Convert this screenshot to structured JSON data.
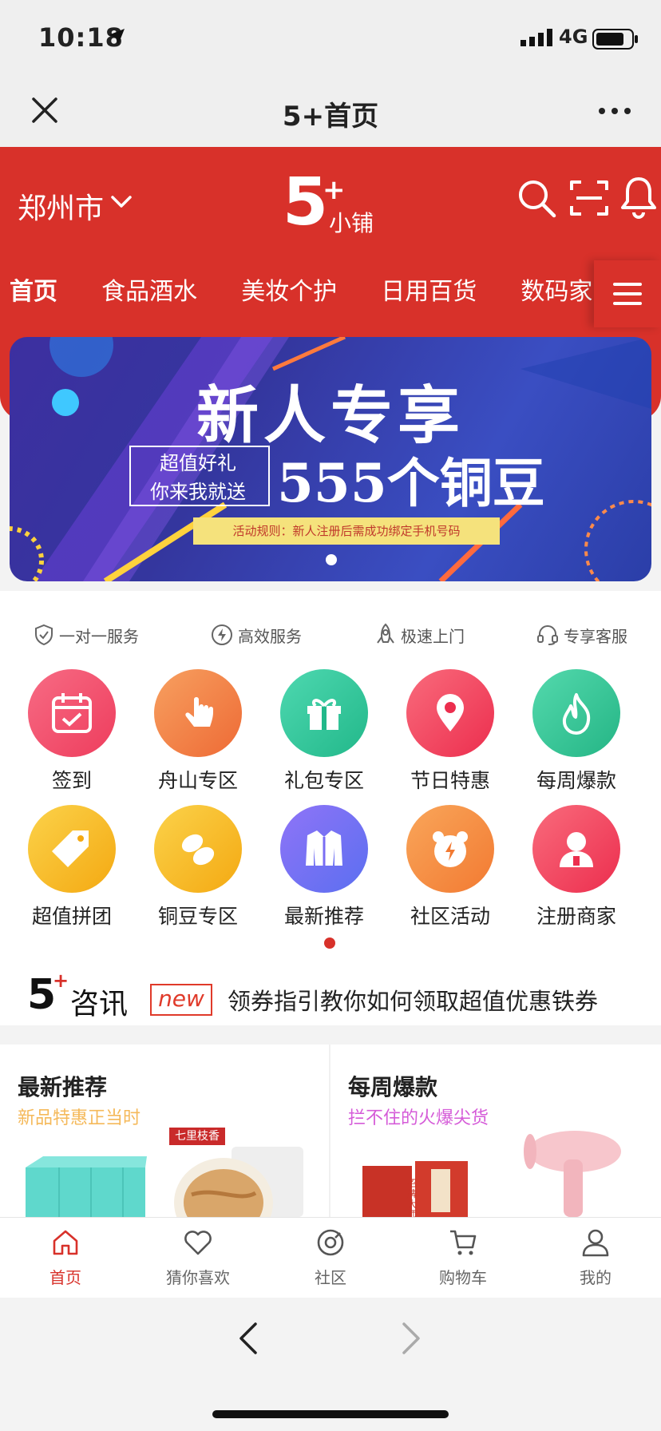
{
  "status": {
    "time": "10:18",
    "network": "4G"
  },
  "titlebar": {
    "title": "5+首页"
  },
  "header": {
    "city": "郑州市",
    "logo": {
      "main": "5",
      "sub": "小铺"
    },
    "tabs": [
      "首页",
      "食品酒水",
      "美妆个护",
      "日用百货",
      "数码家电"
    ]
  },
  "banner": {
    "title": "新人专享",
    "sub_line1": "超值好礼",
    "sub_line2": "你来我就送",
    "highlight": "555个铜豆",
    "rule": "活动规则：新人注册后需成功绑定手机号码"
  },
  "services": [
    "一对一服务",
    "高效服务",
    "极速上门",
    "专享客服"
  ],
  "grid": [
    {
      "label": "签到",
      "icon": "calendar-check-icon",
      "color": "#f04f6c"
    },
    {
      "label": "舟山专区",
      "icon": "tap-hand-icon",
      "color": "#f37b47"
    },
    {
      "label": "礼包专区",
      "icon": "gift-icon",
      "color": "#2fc59b"
    },
    {
      "label": "节日特惠",
      "icon": "location-pin-icon",
      "color": "#f0465f"
    },
    {
      "label": "每周爆款",
      "icon": "flame-icon",
      "color": "#31c796"
    },
    {
      "label": "超值拼团",
      "icon": "tag-icon",
      "color": "#f6b725"
    },
    {
      "label": "铜豆专区",
      "icon": "beans-icon",
      "color": "#f6b725"
    },
    {
      "label": "最新推荐",
      "icon": "jacket-icon",
      "color": "#7a5cf0"
    },
    {
      "label": "社区活动",
      "icon": "bear-bolt-icon",
      "color": "#f7863f"
    },
    {
      "label": "注册商家",
      "icon": "merchant-user-icon",
      "color": "#f0465f"
    }
  ],
  "news": {
    "brand": "咨讯",
    "badge": "new",
    "text": "领券指引教你如何领取超值优惠铁券"
  },
  "cards": [
    {
      "title": "最新推荐",
      "subtitle": "新品特惠正当时",
      "sub_color": "#f5b95a",
      "label_tag": "七里枝香"
    },
    {
      "title": "每周爆款",
      "subtitle": "拦不住的火爆尖货",
      "sub_color": "#d55bd8",
      "label_tag": "招牌大师"
    }
  ],
  "tabbar": [
    {
      "label": "首页",
      "icon": "home-icon"
    },
    {
      "label": "猜你喜欢",
      "icon": "heart-icon"
    },
    {
      "label": "社区",
      "icon": "community-icon"
    },
    {
      "label": "购物车",
      "icon": "cart-icon"
    },
    {
      "label": "我的",
      "icon": "profile-icon"
    }
  ],
  "colors": {
    "brand_red": "#d8312a",
    "banner_blue": "#3a3fb0"
  }
}
